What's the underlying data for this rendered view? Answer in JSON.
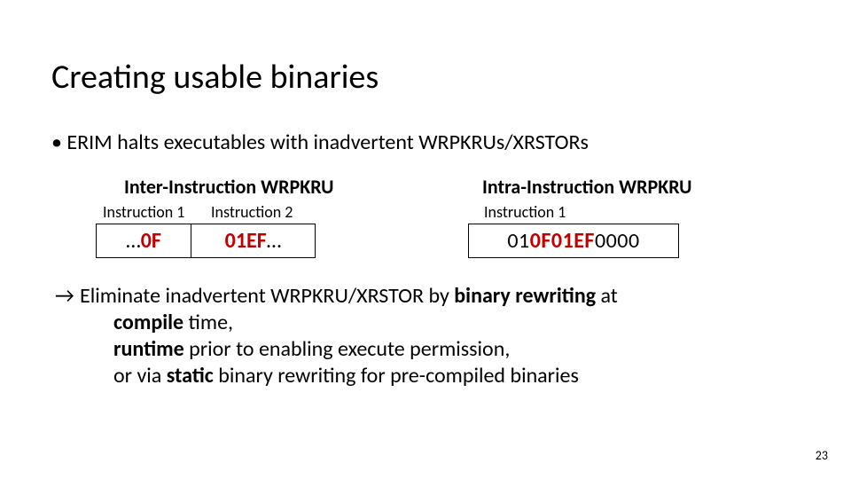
{
  "title": "Creating usable binaries",
  "bullet": "• ERIM halts executables with inadvertent WRPKRUs/XRSTORs",
  "inter": {
    "heading": "Inter-Instruction WRPKRU",
    "label1": "Instruction 1",
    "label2": "Instruction 2",
    "box1_prefix": "…",
    "box1_red": "0F",
    "box2_red": "01EF",
    "box2_suffix": "…"
  },
  "intra": {
    "heading": "Intra-Instruction WRPKRU",
    "label1": "Instruction 1",
    "big_prefix": "01",
    "big_red": "0F01EF",
    "big_suffix": "0000"
  },
  "concl": {
    "arrow": "→",
    "l1a": "Eliminate inadvertent WRPKRU/XRSTOR by ",
    "l1b": "binary rewriting",
    "l1c": " at",
    "l2a": "compile",
    "l2b": " time,",
    "l3a": "runtime",
    "l3b": " prior to enabling execute permission,",
    "l4a": "or via ",
    "l4b": "static",
    "l4c": " binary rewriting for pre-compiled binaries"
  },
  "page": "23"
}
